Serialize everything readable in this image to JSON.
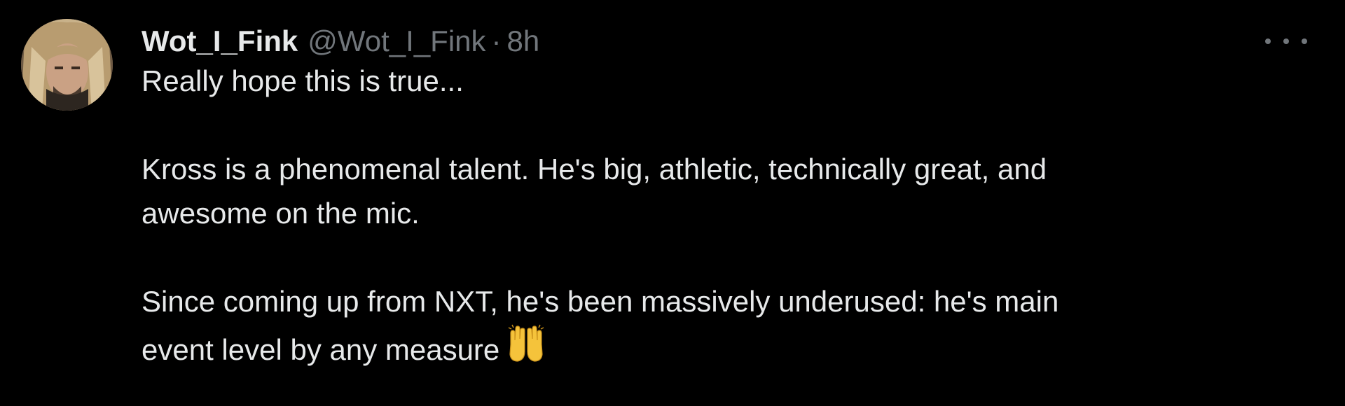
{
  "tweet": {
    "display_name": "Wot_I_Fink",
    "handle": "@Wot_I_Fink",
    "separator": "·",
    "time": "8h",
    "paragraphs": [
      [
        "Really hope this is true..."
      ],
      [
        "Kross is a phenomenal talent. He's big, athletic, technically great, and",
        "awesome on the mic."
      ],
      [
        "Since coming up from NXT, he's been massively underused: he's main",
        "event level by any measure"
      ]
    ],
    "emoji_icon": "raising-hands-icon",
    "more_icon": "more-options-icon"
  },
  "colors": {
    "background": "#000000",
    "primary_text": "#e7e9ea",
    "secondary_text": "#71767b"
  }
}
